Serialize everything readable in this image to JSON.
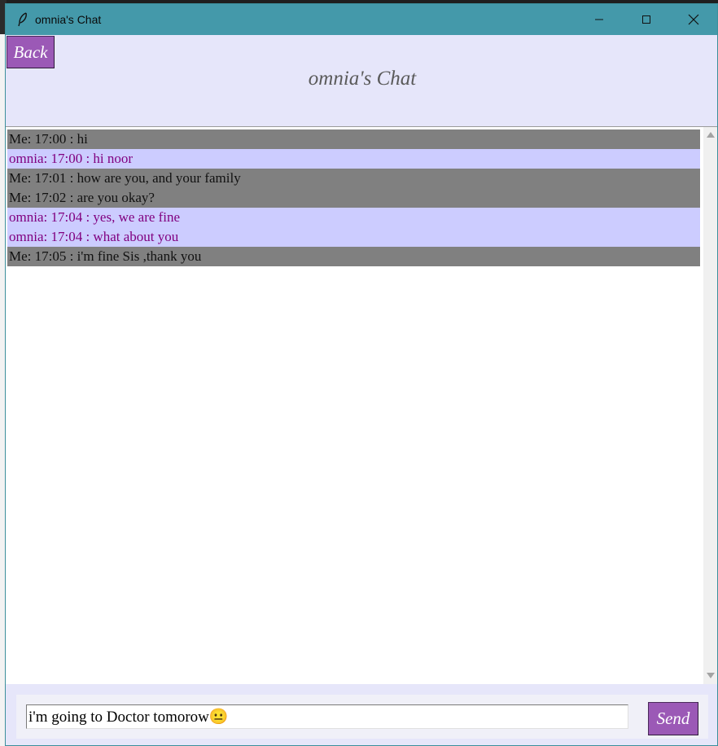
{
  "window": {
    "title": "omnia's Chat",
    "app_icon": "feather-icon",
    "controls": [
      "minimize-icon",
      "maximize-icon",
      "close-icon"
    ]
  },
  "header": {
    "back_label": "Back",
    "title": "omnia's Chat"
  },
  "messages": [
    {
      "sender": "me",
      "text": "Me: 17:00 : hi"
    },
    {
      "sender": "other",
      "text": "omnia: 17:00 : hi noor"
    },
    {
      "sender": "me",
      "text": "Me: 17:01 : how are you, and your family"
    },
    {
      "sender": "me",
      "text": "Me: 17:02 : are you okay?"
    },
    {
      "sender": "other",
      "text": "omnia: 17:04 : yes, we are fine"
    },
    {
      "sender": "other",
      "text": "omnia: 17:04 : what about you"
    },
    {
      "sender": "me",
      "text": "Me: 17:05 : i'm fine Sis ,thank you"
    }
  ],
  "composer": {
    "value": "i'm going to Doctor tomorow😐",
    "send_label": "Send"
  },
  "colors": {
    "titlebar": "#4499aa",
    "header_bg": "#e6e6fa",
    "button_bg": "#9b59b6",
    "my_message_bg": "#808080",
    "other_message_bg": "#ccccff",
    "other_message_text": "#800080"
  }
}
